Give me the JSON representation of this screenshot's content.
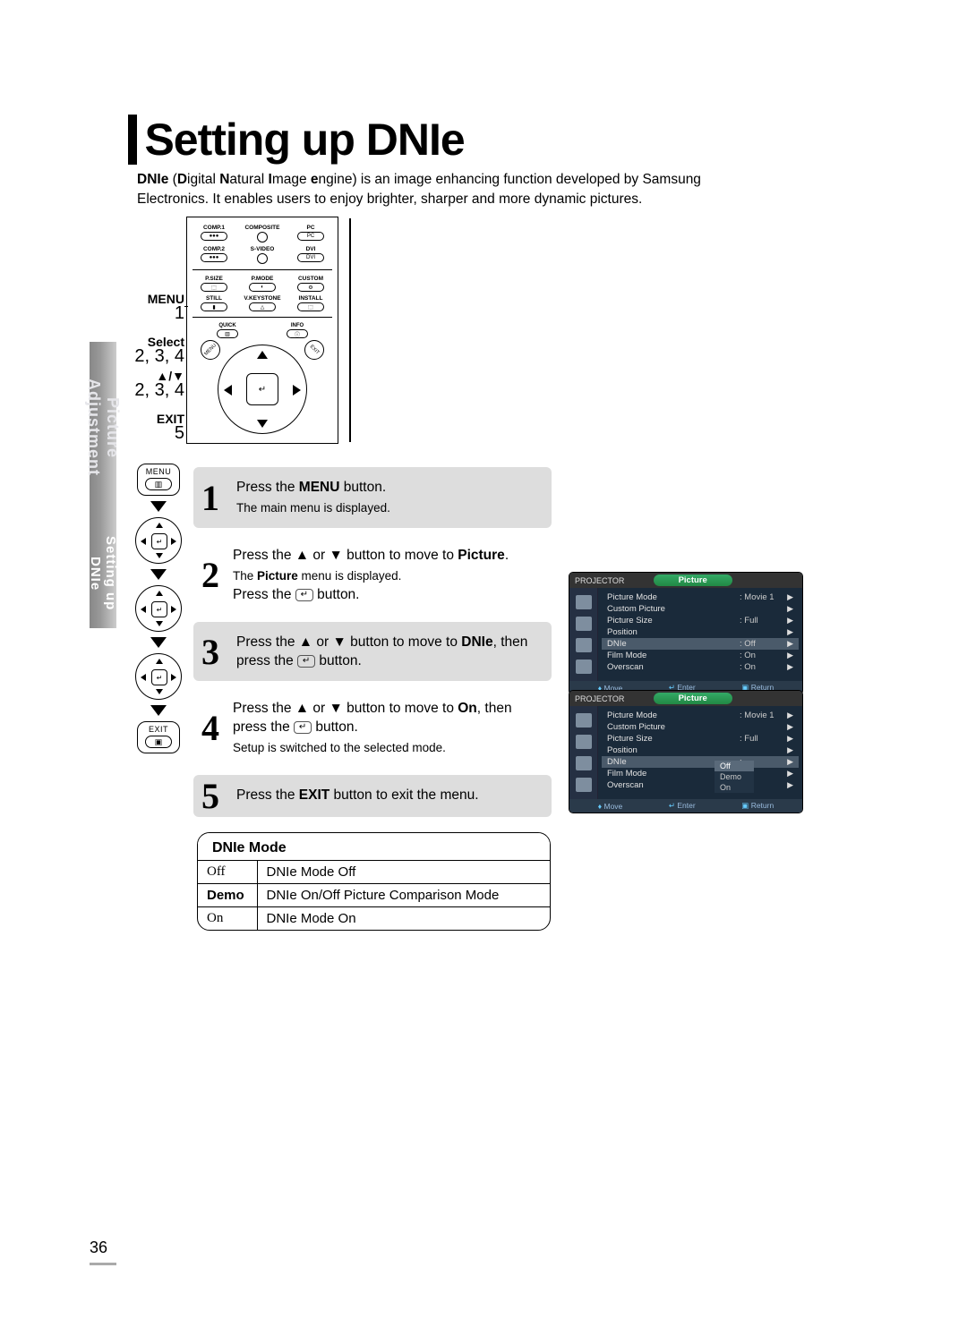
{
  "title": "Setting up DNIe",
  "intro_parts": {
    "dnie": "DNIe",
    "expansion": "(Digital Natural Image engine) is an image enhancing function developed by Samsung Electronics. It enables users to enjoy brighter, sharper and more dynamic pictures.",
    "d": "D",
    "n": "N",
    "i": "I",
    "e": "e"
  },
  "sidebar": {
    "section": "Picture Adjustment",
    "subsection": "Setting up DNIe"
  },
  "remote": {
    "labels": {
      "menu": "MENU",
      "select": "Select",
      "updown": "▲/▼",
      "exit": "EXIT"
    },
    "steps": {
      "menu": "1",
      "select": "2, 3, 4",
      "updown": "2, 3, 4",
      "exit": "5"
    },
    "top_rows": [
      [
        "COMP.1",
        "COMPOSITE",
        "PC"
      ],
      [
        "COMP.2",
        "S-VIDEO",
        "DVI"
      ]
    ],
    "pmode_row": [
      "P.SIZE",
      "P.MODE",
      "CUSTOM"
    ],
    "still_row": [
      "STILL",
      "V.KEYSTONE",
      "INSTALL"
    ],
    "quick_info": [
      "QUICK",
      "INFO"
    ],
    "corner_menu": "MENU",
    "corner_exit": "EXIT"
  },
  "icon_chips": {
    "menu": "MENU",
    "exit": "EXIT"
  },
  "steps": [
    {
      "num": "1",
      "gray": true,
      "lines": [
        {
          "html": "Press the <b>MENU</b> button."
        },
        {
          "small": "The main menu is displayed."
        }
      ]
    },
    {
      "num": "2",
      "gray": false,
      "lines": [
        {
          "html": "Press the ▲ or ▼ button to move to <b>Picture</b>."
        },
        {
          "small_html": "The <b>Picture</b> menu is displayed."
        },
        {
          "html": "Press the <span class='enter-icn'>↵</span> button."
        }
      ]
    },
    {
      "num": "3",
      "gray": true,
      "lines": [
        {
          "html": "Press the ▲ or ▼ button to move to <b>DNIe</b>, then press the <span class='enter-icn'>↵</span> button."
        }
      ]
    },
    {
      "num": "4",
      "gray": false,
      "lines": [
        {
          "html": "Press the ▲ or ▼ button to move to <b>On</b>, then press the <span class='enter-icn'>↵</span> button."
        },
        {
          "small": "Setup is switched to the selected mode."
        }
      ]
    },
    {
      "num": "5",
      "gray": true,
      "lines": [
        {
          "html": "Press the <b>EXIT</b> button to exit the menu."
        }
      ]
    }
  ],
  "osd": {
    "projector_label": "PROJECTOR",
    "tab_label": "Picture",
    "rows": [
      {
        "k": "Picture Mode",
        "v": ": Movie 1",
        "arrow": true
      },
      {
        "k": "Custom Picture",
        "v": "",
        "arrow": true
      },
      {
        "k": "Picture Size",
        "v": ": Full",
        "arrow": true
      },
      {
        "k": "Position",
        "v": "",
        "arrow": true
      },
      {
        "k": "DNIe",
        "v": ": Off",
        "arrow": true,
        "selected": true
      },
      {
        "k": "Film Mode",
        "v": ": On",
        "arrow": true
      },
      {
        "k": "Overscan",
        "v": ": On",
        "arrow": true
      }
    ],
    "footer": [
      "Move",
      "Enter",
      "Return"
    ],
    "options": [
      "Off",
      "Demo",
      "On"
    ],
    "options_selected": "Off"
  },
  "dnie_mode": {
    "title": "DNIe Mode",
    "rows": [
      {
        "k": "Off",
        "bold": false,
        "v": "DNIe Mode Off"
      },
      {
        "k": "Demo",
        "bold": true,
        "v": "DNIe On/Off Picture Comparison Mode"
      },
      {
        "k": "On",
        "bold": false,
        "v": "DNIe Mode On"
      }
    ]
  },
  "page_number": "36"
}
